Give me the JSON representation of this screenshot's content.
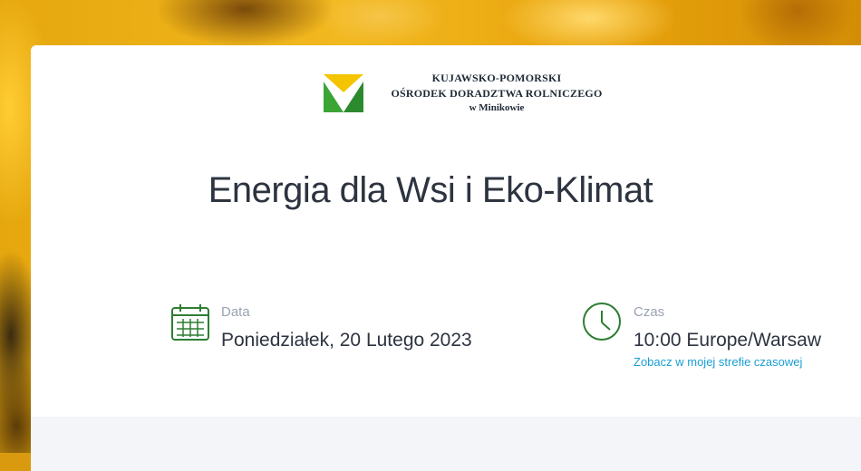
{
  "organization": {
    "line1": "KUJAWSKO-POMORSKI",
    "line2": "OŚRODEK DORADZTWA ROLNICZEGO",
    "line3": "w Minikowie"
  },
  "event": {
    "title": "Energia dla Wsi i Eko-Klimat"
  },
  "date_block": {
    "label": "Data",
    "value": "Poniedziałek, 20 Lutego 2023",
    "icon": "calendar-icon"
  },
  "time_block": {
    "label": "Czas",
    "value": "10:00 Europe/Warsaw",
    "link": "Zobacz w mojej strefie czasowej",
    "icon": "clock-icon"
  },
  "colors": {
    "accent_green": "#2e7d32",
    "link_blue": "#1a9ed1",
    "logo_yellow": "#f5c400",
    "logo_green": "#3aa534"
  }
}
